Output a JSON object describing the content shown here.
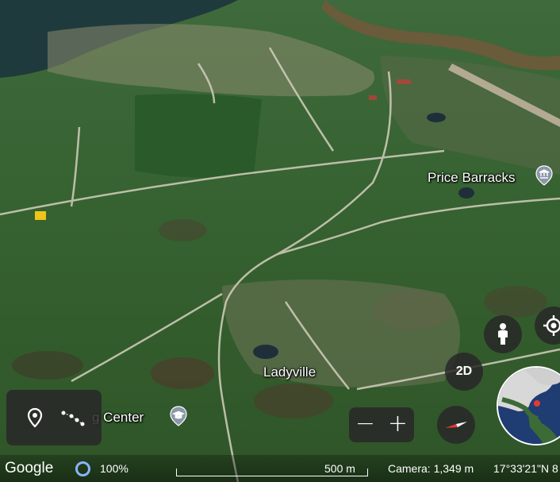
{
  "map": {
    "labels": {
      "price_barracks": "Price Barracks",
      "ladyville": "Ladyville",
      "training_center": "g Center"
    },
    "icons": {
      "museum": "museum-pin-icon",
      "school": "school-pin-icon"
    }
  },
  "controls": {
    "tools": [
      "place-marker-icon",
      "measure-path-icon"
    ],
    "zoom_in": "+",
    "zoom_out": "−",
    "view_toggle": "2D",
    "pegman": "pegman-icon",
    "locate": "my-location-icon",
    "compass": "compass-icon",
    "globe": "mini-globe"
  },
  "statusbar": {
    "logo": "Google",
    "loading_percent": "100%",
    "scale_label": "500 m",
    "camera": "Camera: 1,349 m",
    "coordinates": "17°33'21\"N 8"
  },
  "colors": {
    "panel_bg": "#282828",
    "accent_blue": "#8ab4f8",
    "compass_red": "#e53935",
    "globe_marker": "#e53935"
  }
}
